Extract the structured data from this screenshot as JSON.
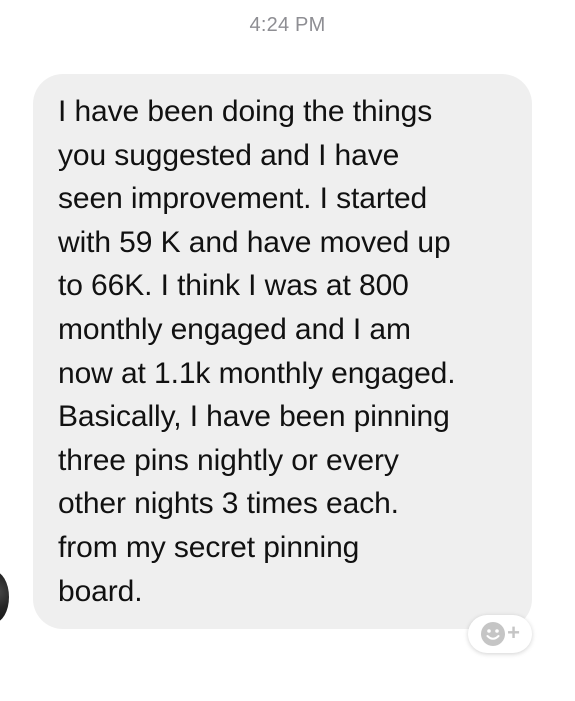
{
  "timestamp": "4:24 PM",
  "message": {
    "lines": [
      "I have been doing the things",
      "you suggested and I have",
      "seen improvement.  I started",
      "with 59 K and have moved up",
      "to 66K.  I think I was at 800",
      "monthly engaged and I am",
      "now at 1.1k monthly engaged.",
      "Basically, I have been pinning",
      "three pins nightly or every",
      "other nights 3 times each.",
      "from my secret pinning",
      "board."
    ]
  },
  "reaction_button": {
    "plus": "+"
  },
  "icons": {
    "avatar": "avatar",
    "reaction": "smiley-icon"
  },
  "colors": {
    "bubble_background": "#efefef",
    "timestamp": "#8e8e93",
    "message_text": "#111111"
  }
}
